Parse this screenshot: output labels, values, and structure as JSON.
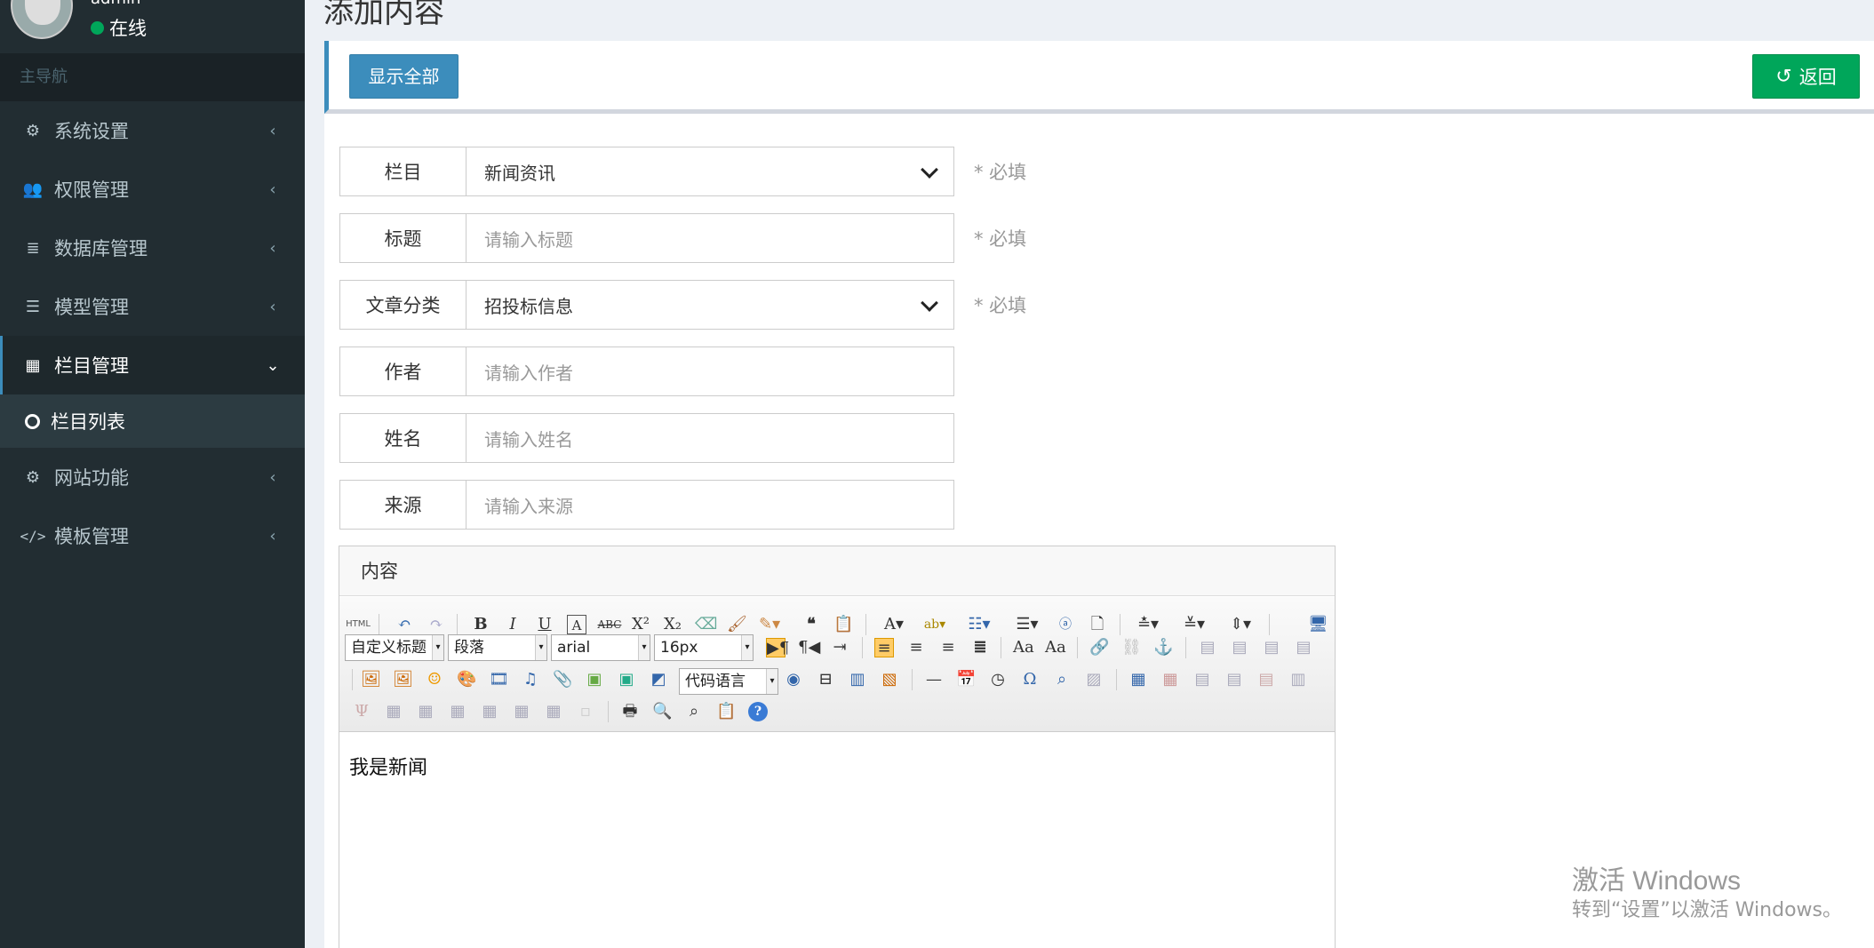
{
  "sidebar": {
    "username": "admin",
    "status": "在线",
    "header": "主导航",
    "items": [
      {
        "label": "系统设置",
        "icon": "gears-icon"
      },
      {
        "label": "权限管理",
        "icon": "users-icon"
      },
      {
        "label": "数据库管理",
        "icon": "database-icon"
      },
      {
        "label": "模型管理",
        "icon": "table-icon"
      },
      {
        "label": "栏目管理",
        "icon": "grid-icon"
      },
      {
        "label": "网站功能",
        "icon": "gear-icon"
      },
      {
        "label": "模板管理",
        "icon": "code-icon"
      }
    ],
    "sub_item": "栏目列表"
  },
  "page": {
    "title": "添加内容",
    "show_all": "显示全部",
    "back": "返回"
  },
  "form": {
    "column": {
      "label": "栏目",
      "value": "新闻资讯",
      "required": "* 必填"
    },
    "title": {
      "label": "标题",
      "placeholder": "请输入标题",
      "required": "* 必填"
    },
    "category": {
      "label": "文章分类",
      "value": "招投标信息",
      "required": "* 必填"
    },
    "author": {
      "label": "作者",
      "placeholder": "请输入作者"
    },
    "name": {
      "label": "姓名",
      "placeholder": "请输入姓名"
    },
    "source": {
      "label": "来源",
      "placeholder": "请输入来源"
    },
    "content_label": "内容"
  },
  "editor": {
    "custom_title": "自定义标题",
    "paragraph": "段落",
    "font": "arial",
    "size": "16px",
    "code_lang": "代码语言",
    "body": "我是新闻"
  },
  "watermark": {
    "line1": "激活 Windows",
    "line2": "转到“设置”以激活 Windows。"
  }
}
